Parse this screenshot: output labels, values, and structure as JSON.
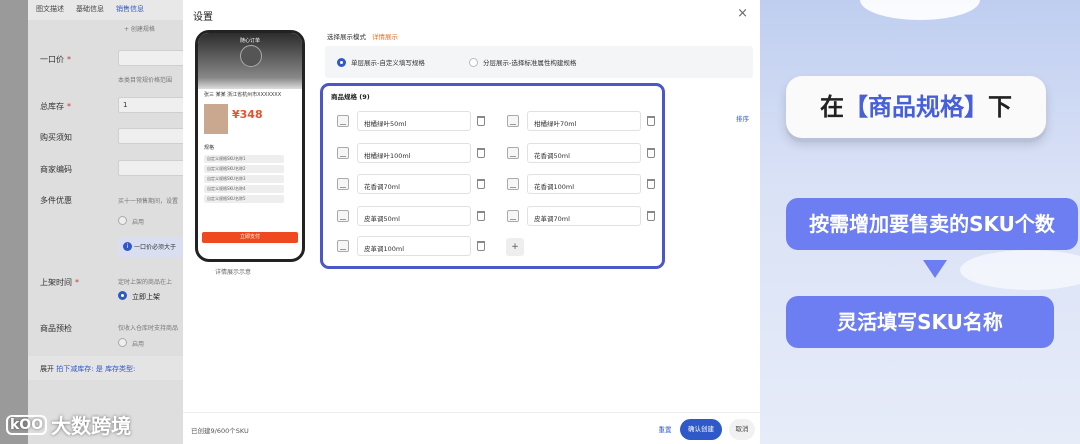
{
  "background_form": {
    "tabs": [
      "图文描述",
      "基础信息",
      "销售信息"
    ],
    "create_spec_btn": "+ 创建规格",
    "fields": [
      {
        "label": "一口价",
        "required": true
      },
      {
        "label": "总库存",
        "required": true,
        "value": "1"
      },
      {
        "label": "购买须知"
      },
      {
        "label": "商家编码"
      },
      {
        "label": "多件优惠"
      },
      {
        "label": "上架时间",
        "required": true
      },
      {
        "label": "商品预检"
      }
    ],
    "notes": {
      "price_note": "本类目常规价格范围",
      "multi_note": "买十一预售期间，设置",
      "enable_label": "启用",
      "info_text": "一口价必须大于",
      "listing_note": "定时上架的商品在上",
      "listing_option": "立即上架",
      "precheck_note": "仅收入仓库时支持商品",
      "precheck_enable": "启用"
    },
    "footer": {
      "expand": "展开",
      "stock_mode": "拍下减库存: 是",
      "stock_type": "库存类型:"
    }
  },
  "watermark": {
    "logo": "kOO",
    "text": "大数跨境"
  },
  "modal": {
    "title": "设置",
    "close": "×",
    "phone": {
      "shop": "随心订单",
      "address": "张三 某某 浙江省杭州市XXXXXXX",
      "price": "¥348",
      "spec_title": "规格",
      "chips": [
        "自定义规格SKU名称1",
        "自定义规格SKU名称2",
        "自定义规格SKU名称3",
        "自定义规格SKU名称4",
        "自定义规格SKU名称5"
      ],
      "buy_btn": "立即支付"
    },
    "phone_caption": "详情展示示意",
    "mode_label": "选择展示模式",
    "mode_link": "详情展示",
    "modes": [
      "单层展示-自定义填写规格",
      "分层展示-选择标准属性构建规格"
    ],
    "selected_mode": 0,
    "spec_title": "商品规格 (9)",
    "skus": [
      "柑橘绿叶50ml",
      "柑橘绿叶70ml",
      "柑橘绿叶100ml",
      "花香调50ml",
      "花香调70ml",
      "花香调100ml",
      "皮革调50ml",
      "皮革调70ml",
      "皮革调100ml"
    ],
    "add_label": "+",
    "sort_link": "排序",
    "footer_count": "已创建9/600个SKU",
    "reset": "重置",
    "confirm": "确认创建",
    "cancel": "取消"
  },
  "promo": {
    "card1_pre": "在",
    "card1_hl": "【商品规格】",
    "card1_post": "下",
    "card2": "按需增加要售卖的SKU个数",
    "card3": "灵活填写SKU名称",
    "accent": "#4760d8"
  }
}
